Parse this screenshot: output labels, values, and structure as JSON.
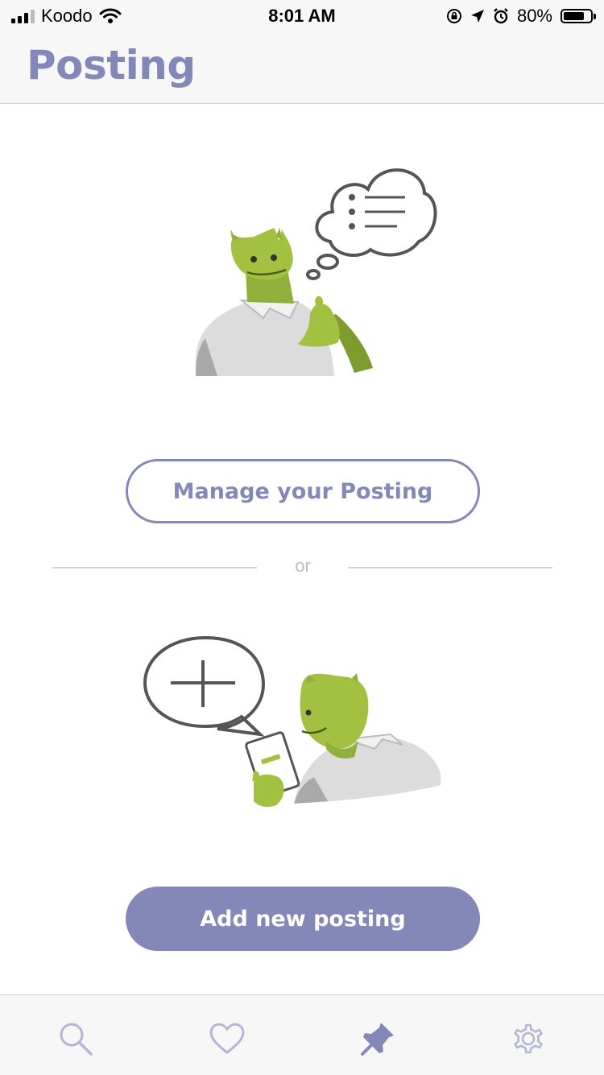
{
  "status_bar": {
    "carrier": "Koodo",
    "time": "8:01 AM",
    "battery_percent": "80%",
    "battery_level": 0.8,
    "icons": [
      "signal-icon",
      "wifi-icon",
      "rotation-lock-icon",
      "location-icon",
      "alarm-icon",
      "battery-icon"
    ]
  },
  "header": {
    "title": "Posting"
  },
  "main": {
    "manage_button_label": "Manage your Posting",
    "divider_text": "or",
    "add_button_label": "Add new posting"
  },
  "tab_bar": {
    "tabs": [
      {
        "icon": "search-icon",
        "active": false
      },
      {
        "icon": "heart-icon",
        "active": false
      },
      {
        "icon": "pushpin-icon",
        "active": true
      },
      {
        "icon": "gear-icon",
        "active": false
      }
    ]
  },
  "colors": {
    "accent": "#8488b8",
    "tab_inactive": "#b3b6d6",
    "character_green": "#a3c141",
    "shirt_gray": "#dcdcdc"
  }
}
